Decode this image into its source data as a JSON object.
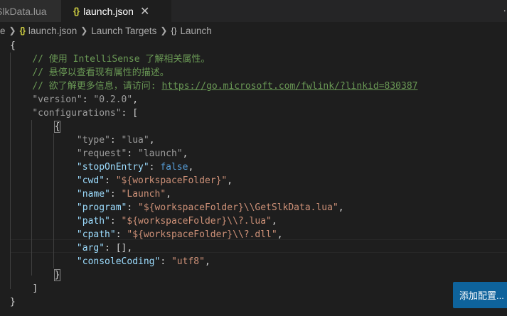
{
  "tabs": [
    {
      "label": "SlkData.lua",
      "active": false
    },
    {
      "label": "launch.json",
      "active": true,
      "icon": "{}"
    }
  ],
  "breadcrumb": {
    "lead": "e",
    "file_icon": "{}",
    "file": "launch.json",
    "segment": "Launch Targets",
    "object_icon": "{}",
    "object": "Launch"
  },
  "editor": {
    "comments": [
      "// 使用 IntelliSense 了解相关属性。",
      "// 悬停以查看现有属性的描述。",
      "// 欲了解更多信息，请访问: "
    ],
    "link": "https://go.microsoft.com/fwlink/?linkid=830387",
    "version_key": "\"version\"",
    "version_value": "\"0.2.0\"",
    "configurations_key": "\"configurations\"",
    "properties": [
      {
        "key": "\"type\"",
        "value": "\"lua\"",
        "dim": true
      },
      {
        "key": "\"request\"",
        "value": "\"launch\"",
        "dim": true
      },
      {
        "key": "\"stopOnEntry\"",
        "value": "false",
        "type": "bool"
      },
      {
        "key": "\"cwd\"",
        "value": "\"${workspaceFolder}\""
      },
      {
        "key": "\"name\"",
        "value": "\"Launch\""
      },
      {
        "key": "\"program\"",
        "value": "\"${workspaceFolder}\\\\GetSlkData.lua\""
      },
      {
        "key": "\"path\"",
        "value": "\"${workspaceFolder}\\\\?.lua\""
      },
      {
        "key": "\"cpath\"",
        "value": "\"${workspaceFolder}\\\\?.dll\""
      },
      {
        "key": "\"arg\"",
        "value": "[]",
        "type": "punc"
      },
      {
        "key": "\"consoleCoding\"",
        "value": "\"utf8\""
      }
    ]
  },
  "add_configuration_button": "添加配置...",
  "colors": {
    "background": "#1e1e1e",
    "comment": "#6a9955",
    "key": "#9cdcfe",
    "string": "#ce9178",
    "bool": "#569cd6",
    "button": "#0e639c"
  }
}
